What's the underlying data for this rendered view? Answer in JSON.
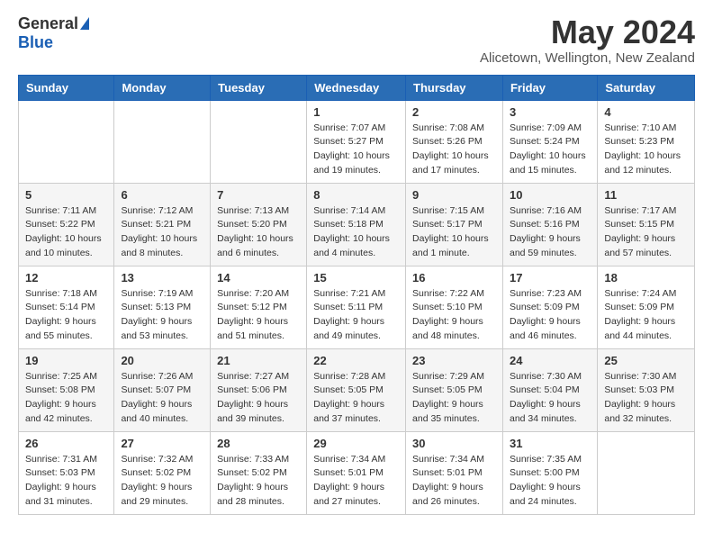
{
  "header": {
    "logo_general": "General",
    "logo_blue": "Blue",
    "month_title": "May 2024",
    "location": "Alicetown, Wellington, New Zealand"
  },
  "days_of_week": [
    "Sunday",
    "Monday",
    "Tuesday",
    "Wednesday",
    "Thursday",
    "Friday",
    "Saturday"
  ],
  "weeks": [
    [
      {
        "day": "",
        "info": ""
      },
      {
        "day": "",
        "info": ""
      },
      {
        "day": "",
        "info": ""
      },
      {
        "day": "1",
        "info": "Sunrise: 7:07 AM\nSunset: 5:27 PM\nDaylight: 10 hours\nand 19 minutes."
      },
      {
        "day": "2",
        "info": "Sunrise: 7:08 AM\nSunset: 5:26 PM\nDaylight: 10 hours\nand 17 minutes."
      },
      {
        "day": "3",
        "info": "Sunrise: 7:09 AM\nSunset: 5:24 PM\nDaylight: 10 hours\nand 15 minutes."
      },
      {
        "day": "4",
        "info": "Sunrise: 7:10 AM\nSunset: 5:23 PM\nDaylight: 10 hours\nand 12 minutes."
      }
    ],
    [
      {
        "day": "5",
        "info": "Sunrise: 7:11 AM\nSunset: 5:22 PM\nDaylight: 10 hours\nand 10 minutes."
      },
      {
        "day": "6",
        "info": "Sunrise: 7:12 AM\nSunset: 5:21 PM\nDaylight: 10 hours\nand 8 minutes."
      },
      {
        "day": "7",
        "info": "Sunrise: 7:13 AM\nSunset: 5:20 PM\nDaylight: 10 hours\nand 6 minutes."
      },
      {
        "day": "8",
        "info": "Sunrise: 7:14 AM\nSunset: 5:18 PM\nDaylight: 10 hours\nand 4 minutes."
      },
      {
        "day": "9",
        "info": "Sunrise: 7:15 AM\nSunset: 5:17 PM\nDaylight: 10 hours\nand 1 minute."
      },
      {
        "day": "10",
        "info": "Sunrise: 7:16 AM\nSunset: 5:16 PM\nDaylight: 9 hours\nand 59 minutes."
      },
      {
        "day": "11",
        "info": "Sunrise: 7:17 AM\nSunset: 5:15 PM\nDaylight: 9 hours\nand 57 minutes."
      }
    ],
    [
      {
        "day": "12",
        "info": "Sunrise: 7:18 AM\nSunset: 5:14 PM\nDaylight: 9 hours\nand 55 minutes."
      },
      {
        "day": "13",
        "info": "Sunrise: 7:19 AM\nSunset: 5:13 PM\nDaylight: 9 hours\nand 53 minutes."
      },
      {
        "day": "14",
        "info": "Sunrise: 7:20 AM\nSunset: 5:12 PM\nDaylight: 9 hours\nand 51 minutes."
      },
      {
        "day": "15",
        "info": "Sunrise: 7:21 AM\nSunset: 5:11 PM\nDaylight: 9 hours\nand 49 minutes."
      },
      {
        "day": "16",
        "info": "Sunrise: 7:22 AM\nSunset: 5:10 PM\nDaylight: 9 hours\nand 48 minutes."
      },
      {
        "day": "17",
        "info": "Sunrise: 7:23 AM\nSunset: 5:09 PM\nDaylight: 9 hours\nand 46 minutes."
      },
      {
        "day": "18",
        "info": "Sunrise: 7:24 AM\nSunset: 5:09 PM\nDaylight: 9 hours\nand 44 minutes."
      }
    ],
    [
      {
        "day": "19",
        "info": "Sunrise: 7:25 AM\nSunset: 5:08 PM\nDaylight: 9 hours\nand 42 minutes."
      },
      {
        "day": "20",
        "info": "Sunrise: 7:26 AM\nSunset: 5:07 PM\nDaylight: 9 hours\nand 40 minutes."
      },
      {
        "day": "21",
        "info": "Sunrise: 7:27 AM\nSunset: 5:06 PM\nDaylight: 9 hours\nand 39 minutes."
      },
      {
        "day": "22",
        "info": "Sunrise: 7:28 AM\nSunset: 5:05 PM\nDaylight: 9 hours\nand 37 minutes."
      },
      {
        "day": "23",
        "info": "Sunrise: 7:29 AM\nSunset: 5:05 PM\nDaylight: 9 hours\nand 35 minutes."
      },
      {
        "day": "24",
        "info": "Sunrise: 7:30 AM\nSunset: 5:04 PM\nDaylight: 9 hours\nand 34 minutes."
      },
      {
        "day": "25",
        "info": "Sunrise: 7:30 AM\nSunset: 5:03 PM\nDaylight: 9 hours\nand 32 minutes."
      }
    ],
    [
      {
        "day": "26",
        "info": "Sunrise: 7:31 AM\nSunset: 5:03 PM\nDaylight: 9 hours\nand 31 minutes."
      },
      {
        "day": "27",
        "info": "Sunrise: 7:32 AM\nSunset: 5:02 PM\nDaylight: 9 hours\nand 29 minutes."
      },
      {
        "day": "28",
        "info": "Sunrise: 7:33 AM\nSunset: 5:02 PM\nDaylight: 9 hours\nand 28 minutes."
      },
      {
        "day": "29",
        "info": "Sunrise: 7:34 AM\nSunset: 5:01 PM\nDaylight: 9 hours\nand 27 minutes."
      },
      {
        "day": "30",
        "info": "Sunrise: 7:34 AM\nSunset: 5:01 PM\nDaylight: 9 hours\nand 26 minutes."
      },
      {
        "day": "31",
        "info": "Sunrise: 7:35 AM\nSunset: 5:00 PM\nDaylight: 9 hours\nand 24 minutes."
      },
      {
        "day": "",
        "info": ""
      }
    ]
  ]
}
